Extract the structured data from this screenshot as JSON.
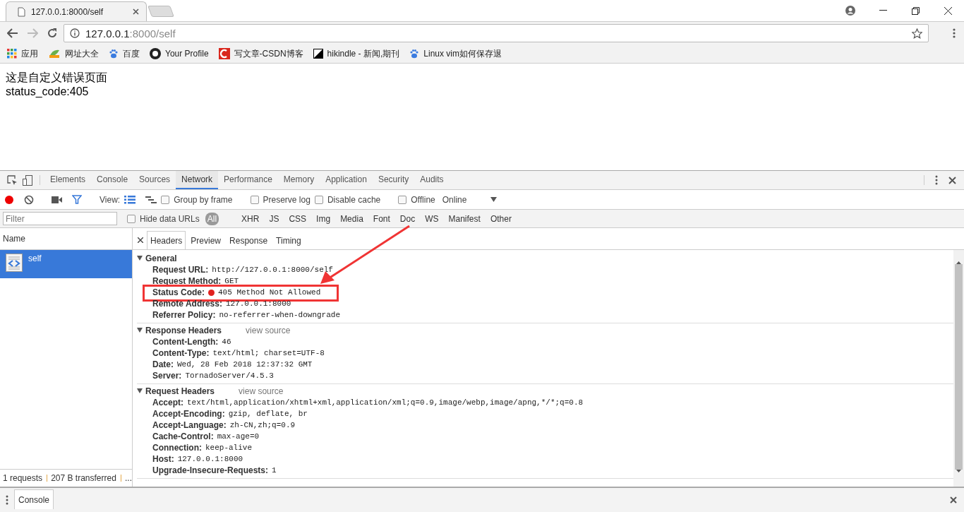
{
  "browser": {
    "tabs": [
      {
        "title": "127.0.0.1:8000/self",
        "selected": true
      }
    ],
    "address": {
      "host": "127.0.0.1",
      "path": ":8000/self"
    },
    "bookmarks": [
      {
        "label": "应用",
        "kind": "apps"
      },
      {
        "label": "网址大全",
        "kind": "hao"
      },
      {
        "label": "百度",
        "kind": "paw"
      },
      {
        "label": "Your Profile",
        "kind": "github"
      },
      {
        "label": "写文章-CSDN博客",
        "kind": "csdn"
      },
      {
        "label": "hikindle - 新闻,期刊",
        "kind": "kindle"
      },
      {
        "label": "Linux vim如何保存退",
        "kind": "paw"
      }
    ]
  },
  "page": {
    "lines": [
      "这是自定义错误页面",
      "status_code:405"
    ]
  },
  "devtools": {
    "panels": [
      {
        "label": "Elements",
        "selected": false
      },
      {
        "label": "Console",
        "selected": false
      },
      {
        "label": "Sources",
        "selected": false
      },
      {
        "label": "Network",
        "selected": true
      },
      {
        "label": "Performance",
        "selected": false
      },
      {
        "label": "Memory",
        "selected": false
      },
      {
        "label": "Application",
        "selected": false
      },
      {
        "label": "Security",
        "selected": false
      },
      {
        "label": "Audits",
        "selected": false
      }
    ],
    "recording": true,
    "view_label": "View:",
    "large_rows": true,
    "options": [
      {
        "label": "Group by frame",
        "checked": false
      },
      {
        "label": "Preserve log",
        "checked": false
      },
      {
        "label": "Disable cache",
        "checked": false
      },
      {
        "label": "Offline",
        "checked": false
      }
    ],
    "throttle": "Online",
    "filter": {
      "placeholder": "Filter"
    },
    "hide_data_urls": {
      "label": "Hide data URLs",
      "checked": false
    },
    "types": [
      {
        "label": "All",
        "selected": true
      },
      {
        "label": "XHR",
        "selected": false
      },
      {
        "label": "JS",
        "selected": false
      },
      {
        "label": "CSS",
        "selected": false
      },
      {
        "label": "Img",
        "selected": false
      },
      {
        "label": "Media",
        "selected": false
      },
      {
        "label": "Font",
        "selected": false
      },
      {
        "label": "Doc",
        "selected": false
      },
      {
        "label": "WS",
        "selected": false
      },
      {
        "label": "Manifest",
        "selected": false
      },
      {
        "label": "Other",
        "selected": false
      }
    ],
    "name_column": "Name",
    "requests": [
      {
        "name": "self",
        "selected": true
      }
    ],
    "summary": [
      "1 requests",
      "207 B transferred",
      "..."
    ],
    "detail_tabs": [
      {
        "label": "Headers",
        "selected": true
      },
      {
        "label": "Preview",
        "selected": false
      },
      {
        "label": "Response",
        "selected": false
      },
      {
        "label": "Timing",
        "selected": false
      }
    ],
    "sections": [
      {
        "title": "General",
        "expanded": true,
        "rows": [
          {
            "key": "Request URL:",
            "value": "http://127.0.0.1:8000/self",
            "highlighted": false
          },
          {
            "key": "Request Method:",
            "value": "GET",
            "highlighted": false
          },
          {
            "key": "Status Code:",
            "value": "405 Method Not Allowed",
            "color": "#e0221f",
            "highlighted": true
          },
          {
            "key": "Remote Address:",
            "value": "127.0.0.1:8000",
            "highlighted": false
          },
          {
            "key": "Referrer Policy:",
            "value": "no-referrer-when-downgrade",
            "highlighted": false
          }
        ]
      },
      {
        "title": "Response Headers",
        "link": "view source",
        "expanded": true,
        "rows": [
          {
            "key": "Content-Length:",
            "value": "46",
            "highlighted": false
          },
          {
            "key": "Content-Type:",
            "value": "text/html; charset=UTF-8",
            "highlighted": false
          },
          {
            "key": "Date:",
            "value": "Wed, 28 Feb 2018 12:37:32 GMT",
            "highlighted": false
          },
          {
            "key": "Server:",
            "value": "TornadoServer/4.5.3",
            "highlighted": false
          }
        ]
      },
      {
        "title": "Request Headers",
        "link": "view source",
        "expanded": true,
        "rows": [
          {
            "key": "Accept:",
            "value": "text/html,application/xhtml+xml,application/xml;q=0.9,image/webp,image/apng,*/*;q=0.8",
            "highlighted": false
          },
          {
            "key": "Accept-Encoding:",
            "value": "gzip, deflate, br",
            "highlighted": false
          },
          {
            "key": "Accept-Language:",
            "value": "zh-CN,zh;q=0.9",
            "highlighted": false
          },
          {
            "key": "Cache-Control:",
            "value": "max-age=0",
            "highlighted": false
          },
          {
            "key": "Connection:",
            "value": "keep-alive",
            "highlighted": false
          },
          {
            "key": "Host:",
            "value": "127.0.0.1:8000",
            "highlighted": false
          },
          {
            "key": "Upgrade-Insecure-Requests:",
            "value": "1",
            "highlighted": false
          }
        ]
      }
    ],
    "drawer_tabs": [
      {
        "label": "Console",
        "selected": true
      }
    ]
  }
}
